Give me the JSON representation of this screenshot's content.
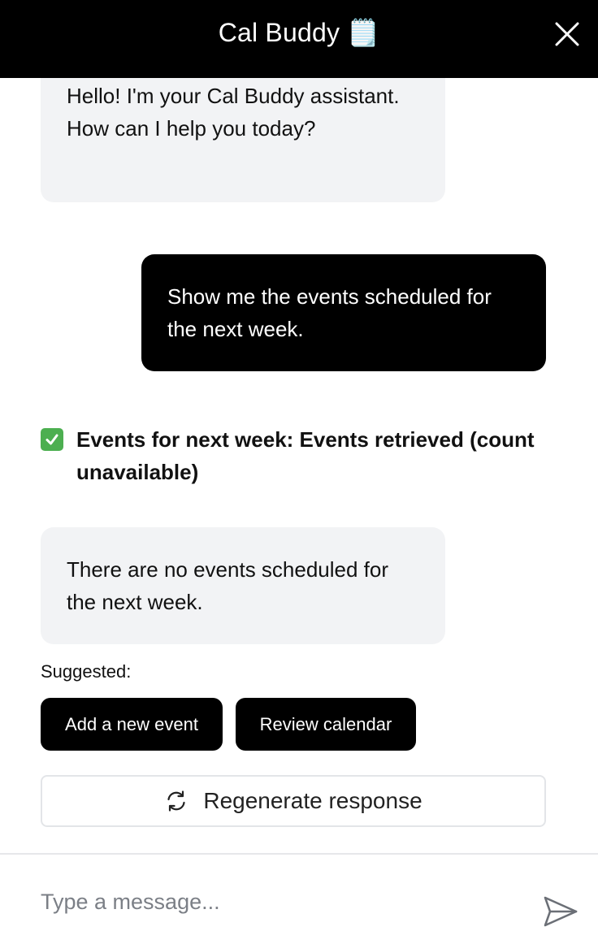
{
  "header": {
    "title": "Cal Buddy 🗒️",
    "close_icon": "close-icon"
  },
  "messages": [
    {
      "role": "assistant",
      "text": "Hello! I'm your Cal Buddy assistant. How can I help you today?"
    },
    {
      "role": "user",
      "text": "Show me the events scheduled for the next week."
    },
    {
      "role": "tool",
      "icon": "check-icon",
      "text": "Events for next week: Events retrieved (count unavailable)"
    },
    {
      "role": "assistant",
      "text": "There are no events scheduled for the next week."
    }
  ],
  "suggestions": {
    "label": "Suggested:",
    "items": [
      "Add a new event",
      "Review calendar"
    ]
  },
  "regenerate": {
    "label": "Regenerate response",
    "icon": "refresh-icon"
  },
  "composer": {
    "placeholder": "Type a message...",
    "value": "",
    "send_icon": "send-icon"
  },
  "colors": {
    "header_bg": "#000000",
    "user_bubble": "#000000",
    "assistant_bubble": "#f2f3f5",
    "check_green": "#4caf50"
  }
}
